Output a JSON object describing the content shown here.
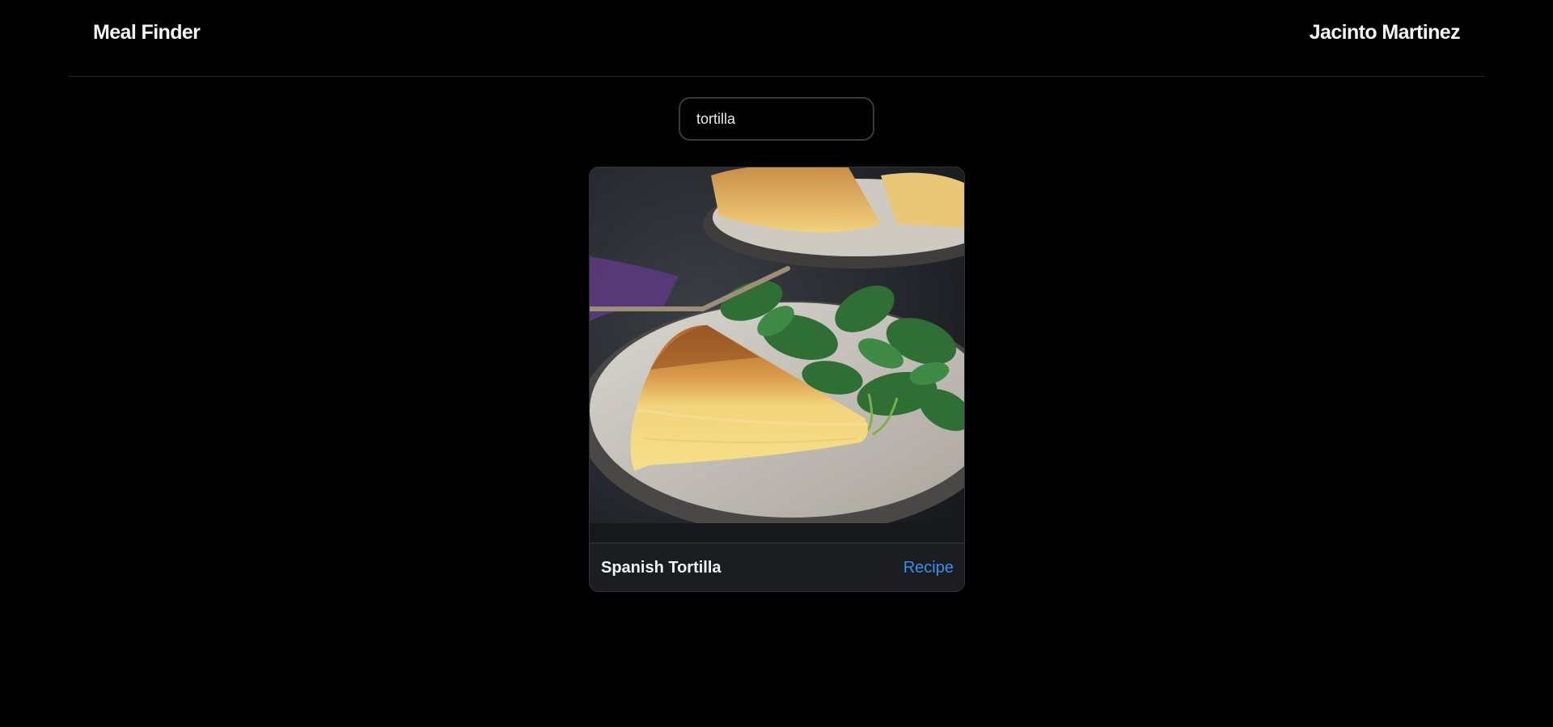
{
  "header": {
    "brand": "Meal Finder",
    "user_name": "Jacinto Martinez"
  },
  "search": {
    "value": "tortilla"
  },
  "results": [
    {
      "meal_name": "Spanish Tortilla",
      "link_label": "Recipe"
    }
  ],
  "colors": {
    "background": "#000000",
    "card": "#1b1d20",
    "link": "#3a8fe8",
    "text": "#f3f3f3"
  }
}
